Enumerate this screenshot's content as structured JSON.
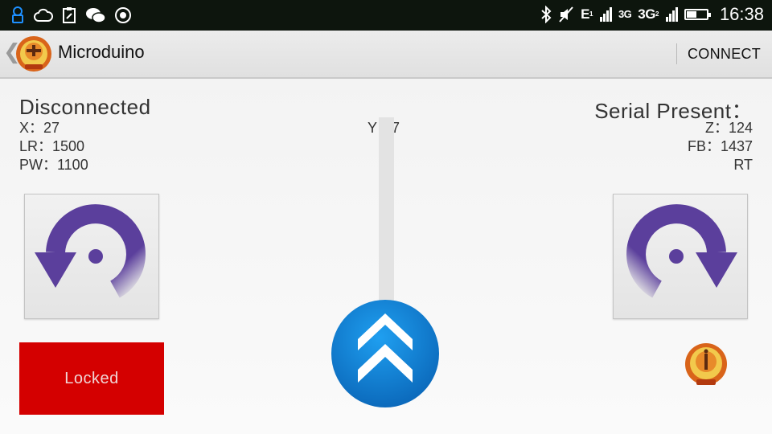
{
  "status_bar": {
    "icons_left": [
      "key-icon",
      "cloud-icon",
      "clipboard-icon",
      "wechat-icon",
      "voice-icon"
    ],
    "icons_right": [
      "bluetooth-icon",
      "mute-icon",
      "signal-icon",
      "battery-icon"
    ],
    "network_1": "E",
    "network_1_sup": "1",
    "network_2": "3G",
    "network_3": "3G",
    "network_3_sup": "2",
    "battery_level": 0.45,
    "time": "16:38"
  },
  "action_bar": {
    "back": "❮",
    "title": "Microduino",
    "connect_label": "CONNECT"
  },
  "left_panel": {
    "status": "Disconnected",
    "x": "X：27",
    "lr": "LR：1500",
    "pw": "PW：1100"
  },
  "center": {
    "y": "Y：7"
  },
  "right_panel": {
    "serial": "Serial Present：",
    "z": "Z：124",
    "fb": "FB：1437",
    "rt": "RT"
  },
  "lock_button": {
    "label": "Locked"
  },
  "colors": {
    "status_bar_bg": "#0d150d",
    "action_bar_bg": "#e6e6e6",
    "rotate_icon": "#5b3f9c",
    "lock_red": "#d40000",
    "throttle_blue": "#0f7fd6",
    "logo_orange": "#e07020"
  },
  "icons": {
    "rotate_left": "rotate-ccw-icon",
    "rotate_right": "rotate-cw-icon",
    "throttle": "double-chevron-up-icon"
  }
}
